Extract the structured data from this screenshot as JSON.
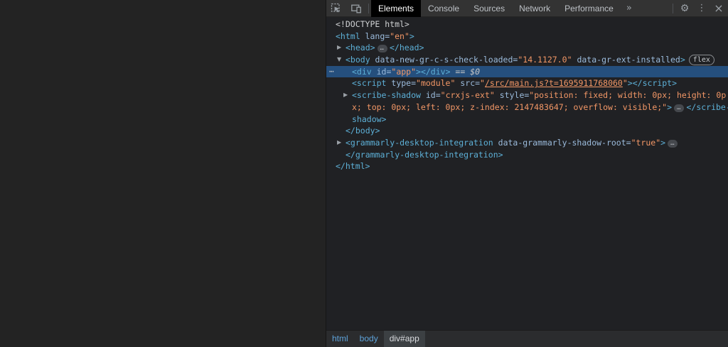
{
  "devtools": {
    "toolbar": {
      "tabs": [
        {
          "label": "Elements",
          "active": true
        },
        {
          "label": "Console",
          "active": false
        },
        {
          "label": "Sources",
          "active": false
        },
        {
          "label": "Network",
          "active": false
        },
        {
          "label": "Performance",
          "active": false
        }
      ],
      "overflow_glyph": "»",
      "settings_glyph": "⚙",
      "menu_glyph": "⋮",
      "close_glyph": "×"
    },
    "tree_glyphs": {
      "chevron_expanded": "▼",
      "chevron_collapsed": "▶"
    },
    "dom_lines": [
      {
        "indent": 13,
        "tokens": [
          {
            "t": "<!DOCTYPE html>",
            "c": "plain"
          }
        ]
      },
      {
        "indent": 13,
        "tokens": [
          {
            "t": "<html ",
            "c": "tag"
          },
          {
            "t": "lang=",
            "c": "attr"
          },
          {
            "t": "\"en\"",
            "c": "val"
          },
          {
            "t": ">",
            "c": "tag"
          }
        ]
      },
      {
        "indent": 27,
        "arrow": "collapsed",
        "tokens": [
          {
            "t": "<head>",
            "c": "tag"
          },
          {
            "t": "…",
            "c": "ellipsis"
          },
          {
            "t": "</head>",
            "c": "tag"
          }
        ]
      },
      {
        "indent": 27,
        "arrow": "expanded",
        "tokens": [
          {
            "t": "<body ",
            "c": "tag"
          },
          {
            "t": "data-new-gr-c-s-check-loaded=",
            "c": "attr"
          },
          {
            "t": "\"14.1127.0\"",
            "c": "val"
          },
          {
            "t": " ",
            "c": "plain"
          },
          {
            "t": "data-gr-ext-installed",
            "c": "attr"
          },
          {
            "t": ">",
            "c": "tag"
          },
          {
            "t": "flex",
            "c": "badge"
          }
        ]
      },
      {
        "indent": 36,
        "selected": true,
        "gutter": "⋯",
        "tokens": [
          {
            "t": "<div ",
            "c": "tag"
          },
          {
            "t": "id=",
            "c": "attr"
          },
          {
            "t": "\"app\"",
            "c": "val"
          },
          {
            "t": "></div>",
            "c": "tag"
          },
          {
            "t": " == $0",
            "c": "eq"
          }
        ]
      },
      {
        "indent": 36,
        "tokens": [
          {
            "t": "<script ",
            "c": "tag"
          },
          {
            "t": "type=",
            "c": "attr"
          },
          {
            "t": "\"module\"",
            "c": "val"
          },
          {
            "t": " ",
            "c": "plain"
          },
          {
            "t": "src=",
            "c": "attr"
          },
          {
            "t": "\"",
            "c": "val"
          },
          {
            "t": "/src/main.js?t=1695911768060",
            "c": "link"
          },
          {
            "t": "\"",
            "c": "val"
          },
          {
            "t": "></script>",
            "c": "tag"
          }
        ]
      },
      {
        "indent": 36,
        "arrow": "collapsed",
        "tokens": [
          {
            "t": "<scribe-shadow ",
            "c": "tag"
          },
          {
            "t": "id=",
            "c": "attr"
          },
          {
            "t": "\"crxjs-ext\"",
            "c": "val"
          },
          {
            "t": " ",
            "c": "plain"
          },
          {
            "t": "style=",
            "c": "attr"
          },
          {
            "t": "\"position: fixed; width: 0px; height: 0p",
            "c": "val"
          }
        ]
      },
      {
        "indent": 36,
        "tokens": [
          {
            "t": "x; top: 0px; left: 0px; z-index: 2147483647; overflow: visible;\"",
            "c": "val"
          },
          {
            "t": ">",
            "c": "tag"
          },
          {
            "t": "…",
            "c": "ellipsis"
          },
          {
            "t": "</scribe-",
            "c": "tag"
          }
        ]
      },
      {
        "indent": 36,
        "tokens": [
          {
            "t": "shadow>",
            "c": "tag"
          }
        ]
      },
      {
        "indent": 27,
        "tokens": [
          {
            "t": "</body>",
            "c": "tag"
          }
        ]
      },
      {
        "indent": 27,
        "arrow": "collapsed",
        "tokens": [
          {
            "t": "<grammarly-desktop-integration ",
            "c": "tag"
          },
          {
            "t": "data-grammarly-shadow-root=",
            "c": "attr"
          },
          {
            "t": "\"true\"",
            "c": "val"
          },
          {
            "t": ">",
            "c": "tag"
          },
          {
            "t": "…",
            "c": "ellipsis"
          }
        ]
      },
      {
        "indent": 27,
        "tokens": [
          {
            "t": "</grammarly-desktop-integration>",
            "c": "tag"
          }
        ]
      },
      {
        "indent": 13,
        "tokens": [
          {
            "t": "</html>",
            "c": "tag"
          }
        ]
      }
    ],
    "breadcrumbs": [
      {
        "label": "html",
        "active": false
      },
      {
        "label": "body",
        "active": false
      },
      {
        "label": "div#app",
        "active": true
      }
    ],
    "colors": {
      "panel_bg": "#202124",
      "toolbar_bg": "#333333",
      "active_tab_bg": "#000000",
      "selection_bg": "#254f7d",
      "tag": "#5db0d7",
      "attr_name": "#9bbbdc",
      "attr_value": "#f29766",
      "page_bg": "#232323"
    }
  }
}
